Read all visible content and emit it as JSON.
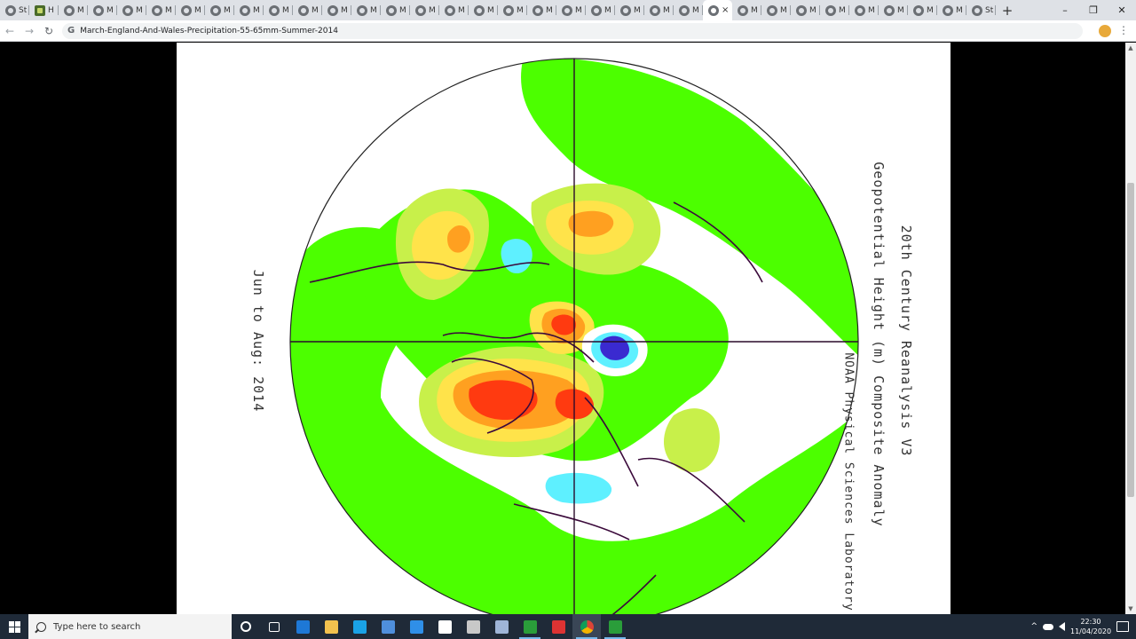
{
  "browser": {
    "tabs": [
      {
        "label": "St",
        "icon": "chrome-page-icon",
        "active": false
      },
      {
        "label": "H",
        "icon": "site-favicon-icon",
        "active": false
      },
      {
        "label": "M",
        "icon": "chrome-page-icon",
        "active": false
      },
      {
        "label": "M",
        "icon": "chrome-page-icon",
        "active": false
      },
      {
        "label": "M",
        "icon": "chrome-page-icon",
        "active": false
      },
      {
        "label": "M",
        "icon": "chrome-page-icon",
        "active": false
      },
      {
        "label": "M",
        "icon": "chrome-page-icon",
        "active": false
      },
      {
        "label": "M",
        "icon": "chrome-page-icon",
        "active": false
      },
      {
        "label": "M",
        "icon": "chrome-page-icon",
        "active": false
      },
      {
        "label": "M",
        "icon": "chrome-page-icon",
        "active": false
      },
      {
        "label": "M",
        "icon": "chrome-page-icon",
        "active": false
      },
      {
        "label": "M",
        "icon": "chrome-page-icon",
        "active": false
      },
      {
        "label": "M",
        "icon": "chrome-page-icon",
        "active": false
      },
      {
        "label": "M",
        "icon": "chrome-page-icon",
        "active": false
      },
      {
        "label": "M",
        "icon": "chrome-page-icon",
        "active": false
      },
      {
        "label": "M",
        "icon": "chrome-page-icon",
        "active": false
      },
      {
        "label": "M",
        "icon": "chrome-page-icon",
        "active": false
      },
      {
        "label": "M",
        "icon": "chrome-page-icon",
        "active": false
      },
      {
        "label": "M",
        "icon": "chrome-page-icon",
        "active": false
      },
      {
        "label": "M",
        "icon": "chrome-page-icon",
        "active": false
      },
      {
        "label": "M",
        "icon": "chrome-page-icon",
        "active": false
      },
      {
        "label": "M",
        "icon": "chrome-page-icon",
        "active": false
      },
      {
        "label": "M",
        "icon": "chrome-page-icon",
        "active": false
      },
      {
        "label": "M",
        "icon": "chrome-page-icon",
        "active": false
      },
      {
        "label": "×",
        "icon": "chrome-page-icon",
        "active": true
      },
      {
        "label": "M",
        "icon": "chrome-page-icon",
        "active": false
      },
      {
        "label": "M",
        "icon": "chrome-page-icon",
        "active": false
      },
      {
        "label": "M",
        "icon": "chrome-page-icon",
        "active": false
      },
      {
        "label": "M",
        "icon": "chrome-page-icon",
        "active": false
      },
      {
        "label": "M",
        "icon": "chrome-page-icon",
        "active": false
      },
      {
        "label": "M",
        "icon": "chrome-page-icon",
        "active": false
      },
      {
        "label": "M",
        "icon": "chrome-page-icon",
        "active": false
      },
      {
        "label": "M",
        "icon": "chrome-page-icon",
        "active": false
      },
      {
        "label": "St",
        "icon": "chrome-page-icon",
        "active": false
      }
    ],
    "new_tab": "+",
    "window_controls": {
      "minimize": "–",
      "restore": "❐",
      "close": "✕"
    },
    "nav": {
      "back": "←",
      "forward": "→",
      "reload": "↻"
    },
    "omnibox_icon": "G",
    "url": "March-England-And-Wales-Precipitation-55-65mm-Summer-2014",
    "menu": "⋮"
  },
  "figure": {
    "title": "20th Century Reanalysis V3",
    "subtitle": "Geopotential Height (m) Composite Anomaly",
    "credit": "NOAA Physical Sciences Laboratory",
    "period": "Jun to Aug: 2014",
    "colors": {
      "land_background": "#ffffff",
      "weak_positive": "#4cff00",
      "moderate_positive": "#c8f04a",
      "yellow": "#ffe34a",
      "orange": "#ffa020",
      "red": "#ff3a10",
      "light_negative": "#5ef0ff",
      "strong_negative": "#3a2ad0",
      "coastline": "#3b0a3b"
    }
  },
  "taskbar": {
    "search_placeholder": "Type here to search",
    "pinned": [
      {
        "name": "cortana-icon",
        "running": false
      },
      {
        "name": "task-view-icon",
        "running": false
      },
      {
        "name": "mail-icon",
        "running": false
      },
      {
        "name": "file-explorer-icon",
        "running": false
      },
      {
        "name": "edge-icon",
        "running": false
      },
      {
        "name": "onedrive-icon",
        "running": false
      },
      {
        "name": "calendar-icon",
        "running": false
      },
      {
        "name": "paint-icon",
        "running": false
      },
      {
        "name": "app-icon-1",
        "running": false
      },
      {
        "name": "app-icon-2",
        "running": false
      },
      {
        "name": "camtasia-icon",
        "running": true
      },
      {
        "name": "pdf-icon",
        "running": false
      },
      {
        "name": "chrome-icon",
        "running": true
      },
      {
        "name": "camtasia-recorder-icon",
        "running": true
      }
    ],
    "tray": {
      "chevron": "^",
      "time": "22:30",
      "date": "11/04/2020"
    }
  }
}
